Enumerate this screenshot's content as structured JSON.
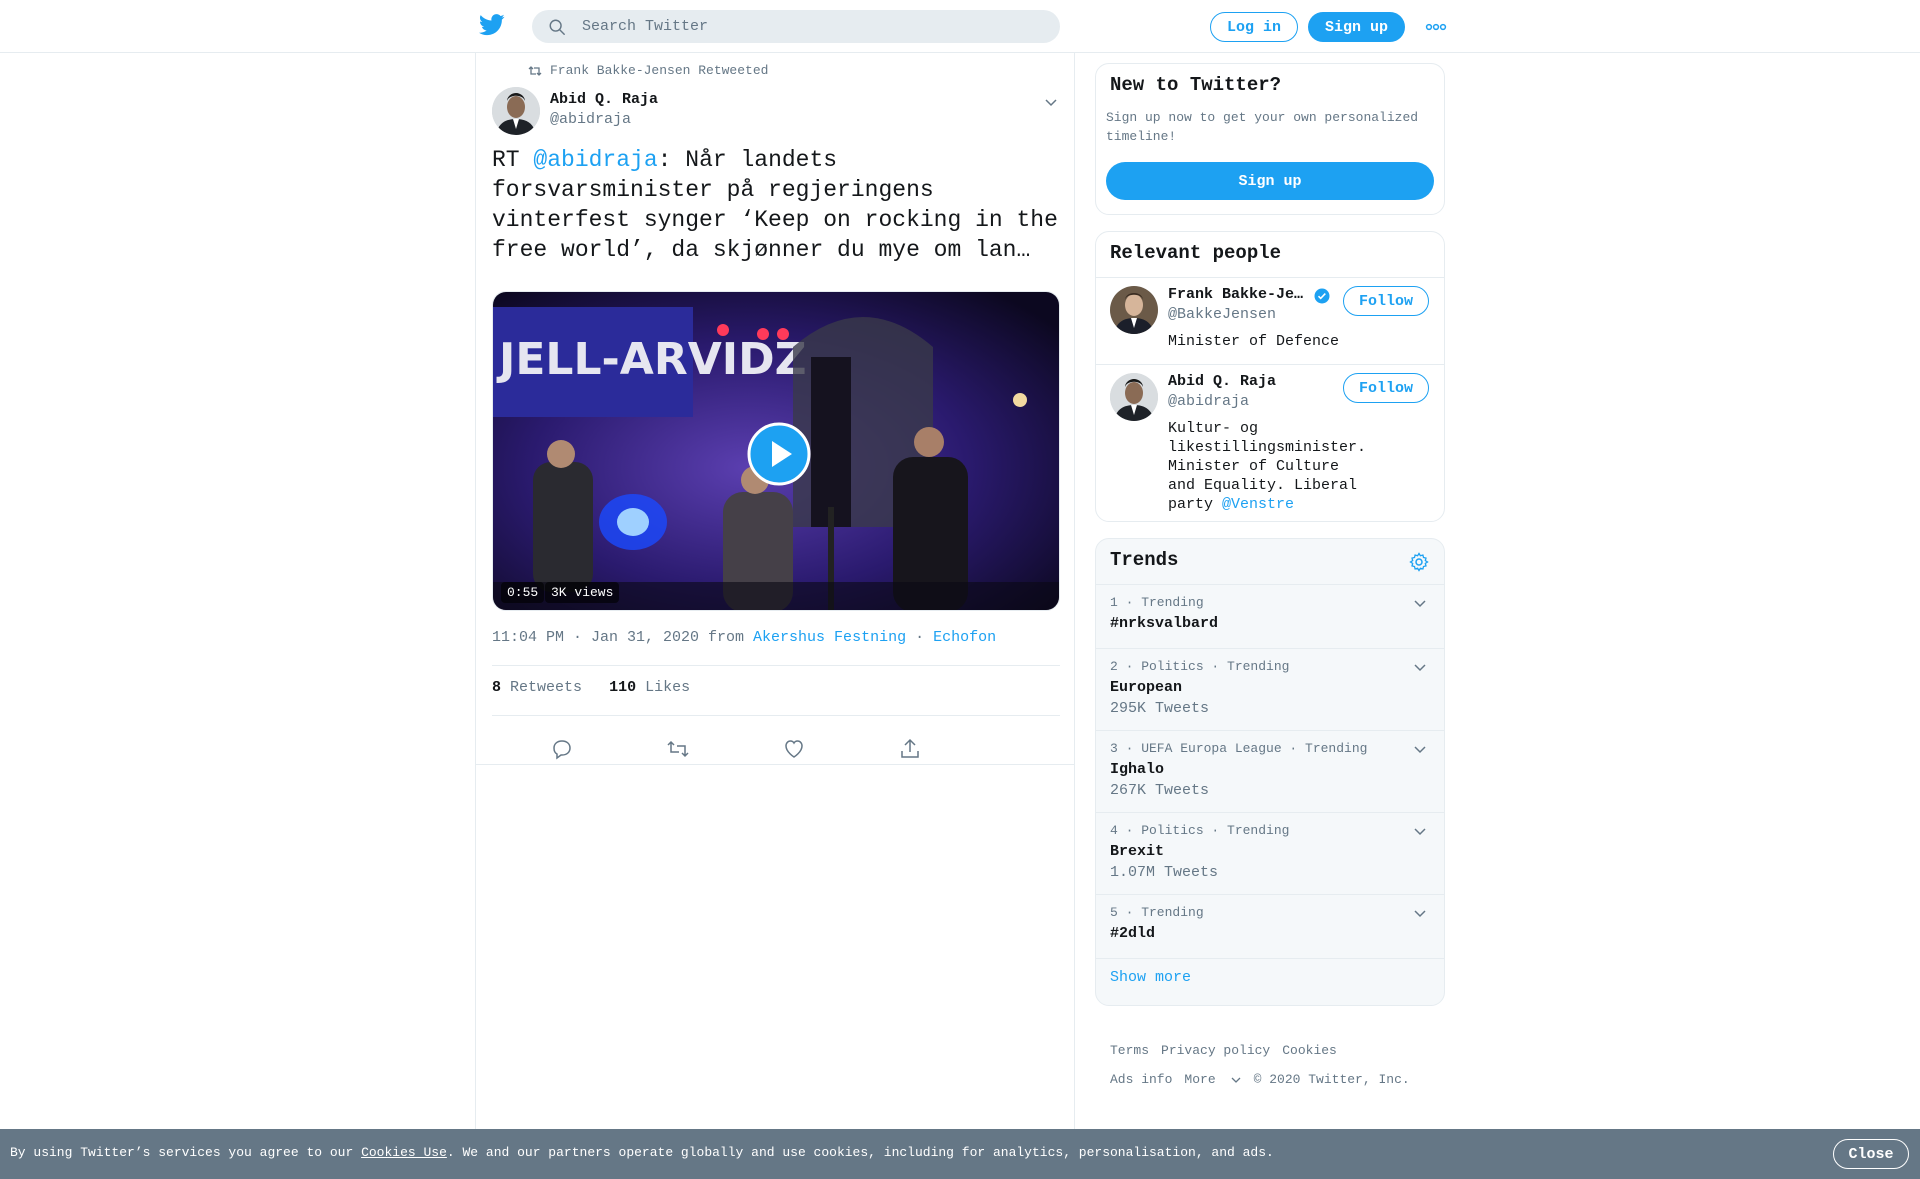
{
  "header": {
    "search_placeholder": "Search Twitter",
    "login_label": "Log in",
    "signup_label": "Sign up"
  },
  "tweet": {
    "retweeted_by": "Frank Bakke-Jensen Retweeted",
    "author_name": "Abid Q. Raja",
    "author_handle": "@abidraja",
    "text_prefix": "RT ",
    "text_mention": "@abidraja",
    "text_body": ": Når landets forsvarsminister på regjeringens vinterfest synger ‘Keep on rocking in the free world’, da skjønner du mye om lan…",
    "video_duration": "0:55",
    "video_views": "3K views",
    "timestamp": "11:04 PM · Jan 31, 2020 from ",
    "location": "Akershus Festning",
    "dot": " · ",
    "source": "Echofon",
    "retweets_count": "8",
    "retweets_label": "Retweets",
    "likes_count": "110",
    "likes_label": "Likes"
  },
  "signup_card": {
    "title": "New to Twitter?",
    "description": "Sign up now to get your own personalized timeline!",
    "button_label": "Sign up"
  },
  "relevant_people": {
    "title": "Relevant people",
    "people": [
      {
        "name": "Frank Bakke-Jensen",
        "handle": "@BakkeJensen",
        "bio": "Minister of Defence",
        "follow_label": "Follow",
        "verified": true
      },
      {
        "name": "Abid Q. Raja",
        "handle": "@abidraja",
        "bio": "Kultur- og likestillingsminister. Minister of Culture and Equality. Liberal party ",
        "bio_mention": "@Venstre",
        "follow_label": "Follow",
        "verified": false
      }
    ]
  },
  "trends": {
    "title": "Trends",
    "items": [
      {
        "context": "1 · Trending",
        "name": "#nrksvalbard",
        "count": ""
      },
      {
        "context": "2 · Politics · Trending",
        "name": "European",
        "count": "295K Tweets"
      },
      {
        "context": "3 · UEFA Europa League · Trending",
        "name": "Ighalo",
        "count": "267K Tweets"
      },
      {
        "context": "4 · Politics · Trending",
        "name": "Brexit",
        "count": "1.07M Tweets"
      },
      {
        "context": "5 · Trending",
        "name": "#2dld",
        "count": ""
      }
    ],
    "show_more": "Show more"
  },
  "footer": {
    "terms": "Terms",
    "privacy": "Privacy policy",
    "cookies": "Cookies",
    "ads_info": "Ads info",
    "more": "More",
    "copyright": "© 2020 Twitter, Inc."
  },
  "cookie_bar": {
    "text_before": "By using Twitter’s services you agree to our ",
    "link": "Cookies Use",
    "text_after": ". We and our partners operate globally and use cookies, including for analytics, personalisation, and ads.",
    "close_label": "Close"
  },
  "colors": {
    "accent": "#1da1f2",
    "muted": "#657786",
    "border": "#e6ecf0",
    "cookie_bg": "#657786"
  }
}
